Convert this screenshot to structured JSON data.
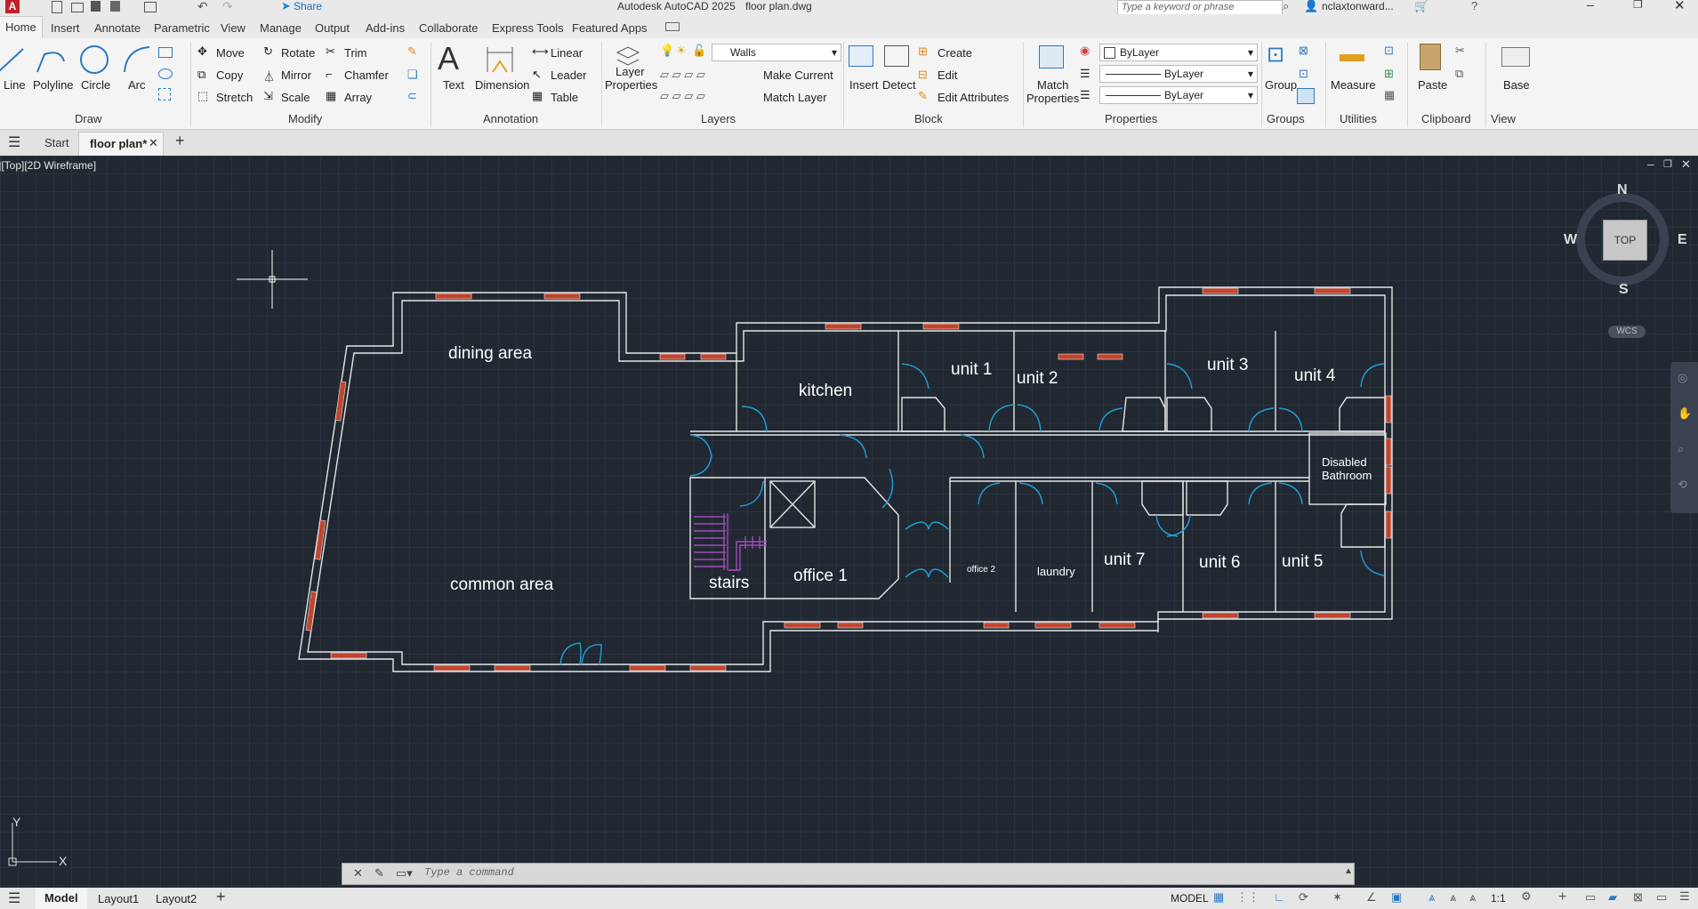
{
  "titlebar": {
    "app_title": "Autodesk AutoCAD 2025",
    "file_name": "floor plan.dwg",
    "share_label": "Share",
    "search_placeholder": "Type a keyword or phrase",
    "user_name": "nclaxtonward..."
  },
  "tabs": [
    "Home",
    "Insert",
    "Annotate",
    "Parametric",
    "View",
    "Manage",
    "Output",
    "Add-ins",
    "Collaborate",
    "Express Tools",
    "Featured Apps"
  ],
  "ribbon": {
    "draw": {
      "line": "Line",
      "polyline": "Polyline",
      "circle": "Circle",
      "arc": "Arc",
      "panel": "Draw"
    },
    "modify": {
      "move": "Move",
      "rotate": "Rotate",
      "trim": "Trim",
      "copy": "Copy",
      "mirror": "Mirror",
      "chamfer": "Chamfer",
      "stretch": "Stretch",
      "scale": "Scale",
      "array": "Array",
      "panel": "Modify"
    },
    "annotation": {
      "text": "Text",
      "dimension": "Dimension",
      "linear": "Linear",
      "leader": "Leader",
      "table": "Table",
      "panel": "Annotation"
    },
    "layers": {
      "layer_properties_1": "Layer",
      "layer_properties_2": "Properties",
      "current_layer": "Walls",
      "make_current": "Make Current",
      "match_layer": "Match Layer",
      "panel": "Layers"
    },
    "block": {
      "insert": "Insert",
      "detect": "Detect",
      "create": "Create",
      "edit": "Edit",
      "edit_attributes": "Edit Attributes",
      "panel": "Block"
    },
    "properties": {
      "match_1": "Match",
      "match_2": "Properties",
      "color": "ByLayer",
      "linetype": "ByLayer",
      "lineweight": "ByLayer",
      "panel": "Properties"
    },
    "groups": {
      "group": "Group",
      "panel": "Groups"
    },
    "utilities": {
      "measure": "Measure",
      "panel": "Utilities"
    },
    "clipboard": {
      "paste": "Paste",
      "panel": "Clipboard"
    },
    "view": {
      "base": "Base",
      "panel": "View"
    }
  },
  "doc_tabs": {
    "start": "Start",
    "active": "floor plan*"
  },
  "viewport": {
    "label": "-][Top][2D Wireframe]"
  },
  "viewcube": {
    "n": "N",
    "s": "S",
    "e": "E",
    "w": "W",
    "top": "TOP",
    "wcs": "WCS"
  },
  "rooms": {
    "dining": "dining area",
    "common": "common area",
    "kitchen": "kitchen",
    "stairs": "stairs",
    "office1": "office 1",
    "office2": "office 2",
    "laundry": "laundry",
    "unit1": "unit 1",
    "unit2": "unit 2",
    "unit3": "unit 3",
    "unit4": "unit 4",
    "unit5": "unit 5",
    "unit6": "unit 6",
    "unit7": "unit 7",
    "disabled1": "Disabled",
    "disabled2": "Bathroom"
  },
  "ucs": {
    "x": "X",
    "y": "Y"
  },
  "command": {
    "placeholder": "Type a command"
  },
  "layout_tabs": [
    "Model",
    "Layout1",
    "Layout2"
  ],
  "status": {
    "model": "MODEL",
    "scale": "1:1"
  },
  "colors": {
    "wall": "#e6e6e6",
    "window": "#c0462e",
    "door": "#1e9fd4",
    "stair": "#a04ab8",
    "canvas": "#212832"
  }
}
